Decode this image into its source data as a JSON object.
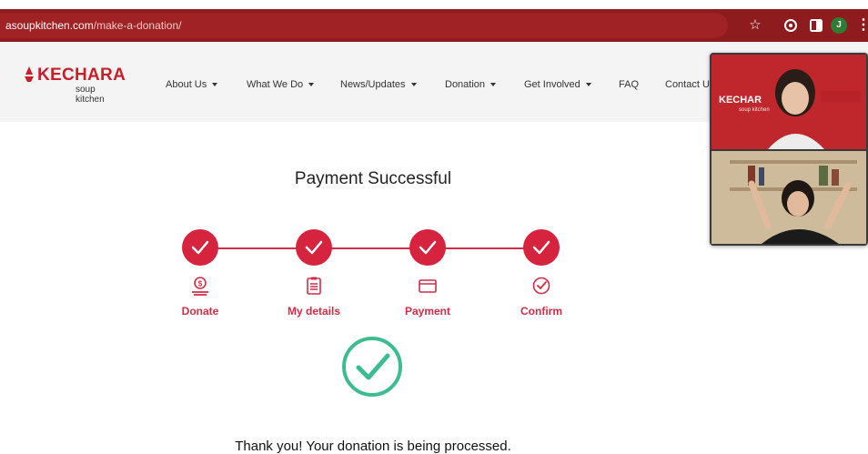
{
  "browser": {
    "url_domain": "asoupkitchen.com",
    "url_path": "/make-a-donation/",
    "avatar_letter": "J"
  },
  "site": {
    "logo_text": "KECHARA",
    "logo_sub": "soup kitchen",
    "nav": [
      {
        "label": "About Us",
        "has_caret": true
      },
      {
        "label": "What We Do",
        "has_caret": true
      },
      {
        "label": "News/Updates",
        "has_caret": true
      },
      {
        "label": "Donation",
        "has_caret": true
      },
      {
        "label": "Get Involved",
        "has_caret": true
      },
      {
        "label": "FAQ",
        "has_caret": false
      },
      {
        "label": "Contact U",
        "has_caret": false
      }
    ]
  },
  "payment": {
    "title": "Payment Successful",
    "steps": [
      {
        "label": "Donate",
        "icon": "donate-hand-coin-icon"
      },
      {
        "label": "My details",
        "icon": "clipboard-icon"
      },
      {
        "label": "Payment",
        "icon": "card-icon"
      },
      {
        "label": "Confirm",
        "icon": "check-circle-icon"
      }
    ],
    "message": "Thank you! Your donation is being processed."
  },
  "video_call": {
    "tile1_logo": "KECHAR",
    "tile1_sub": "soup kitchen"
  },
  "colors": {
    "browser_bar": "#8e1b1e",
    "brand_red": "#d6243f",
    "success_green": "#3dbd8f"
  }
}
